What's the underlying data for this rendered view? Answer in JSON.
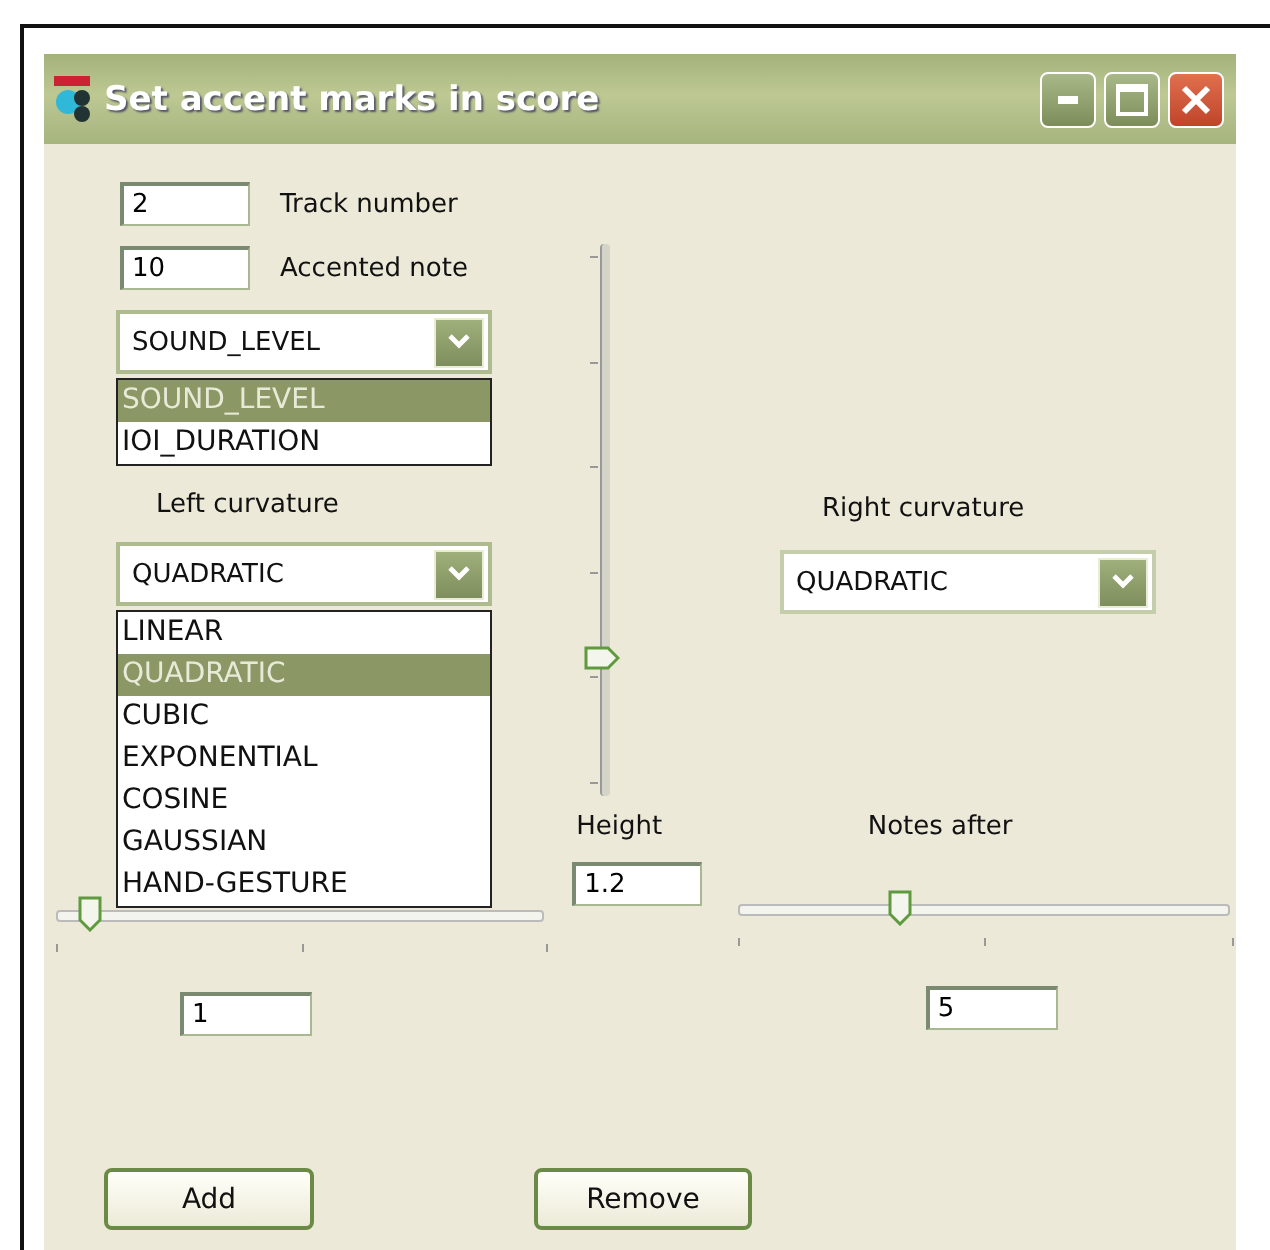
{
  "window": {
    "title": "Set accent marks in score"
  },
  "fields": [
    {
      "label": "Track number",
      "value": "2"
    },
    {
      "label": "Accented note",
      "value": "10"
    }
  ],
  "accent_type": {
    "value": "SOUND_LEVEL",
    "expanded": true,
    "options": [
      {
        "label": "SOUND_LEVEL",
        "selected": true
      },
      {
        "label": "IOI_DURATION",
        "selected": false
      }
    ]
  },
  "left_curvature": {
    "label": "Left curvature",
    "value": "QUADRATIC",
    "expanded": true,
    "options": [
      {
        "label": "LINEAR",
        "selected": false
      },
      {
        "label": "QUADRATIC",
        "selected": true
      },
      {
        "label": "CUBIC",
        "selected": false
      },
      {
        "label": "EXPONENTIAL",
        "selected": false
      },
      {
        "label": "COSINE",
        "selected": false
      },
      {
        "label": "GAUSSIAN",
        "selected": false
      },
      {
        "label": "HAND-GESTURE",
        "selected": false
      }
    ]
  },
  "right_curvature": {
    "label": "Right curvature",
    "value": "QUADRATIC"
  },
  "height": {
    "label": "Height",
    "value": "1.2",
    "level": 0.25
  },
  "notes_before": {
    "value": "1",
    "level": 0.07
  },
  "notes_after": {
    "label": "Notes after",
    "value": "5",
    "level": 0.33
  },
  "buttons": [
    "Add",
    "Remove"
  ]
}
